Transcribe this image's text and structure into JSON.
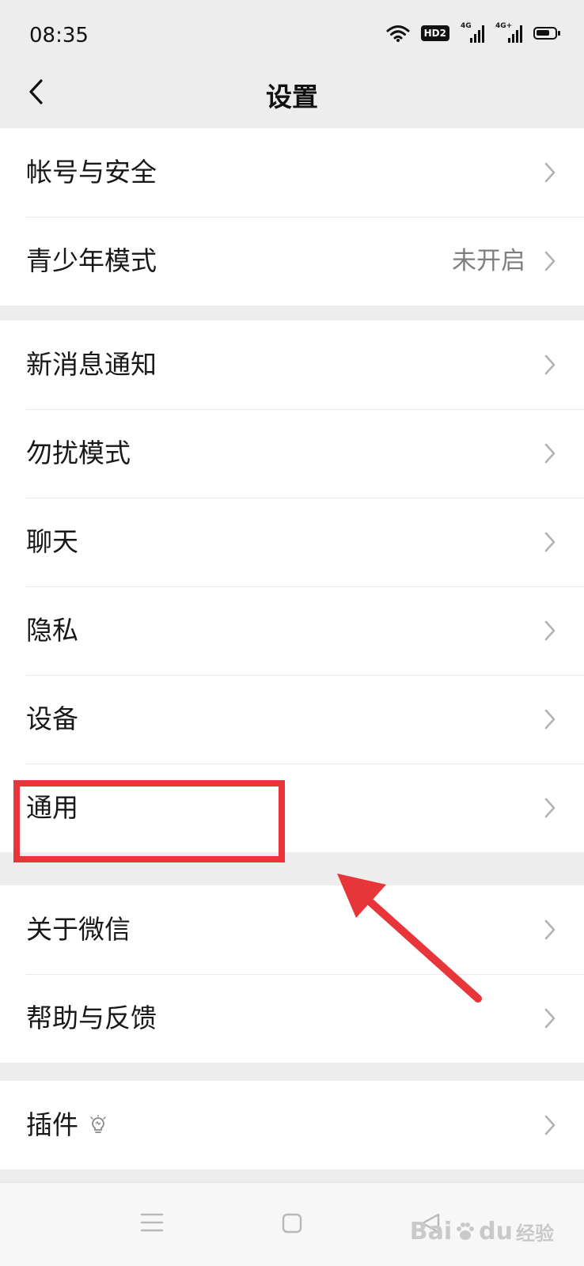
{
  "status_bar": {
    "time": "08:35",
    "hd_label": "HD2",
    "signal1_label": "4G",
    "signal2_label": "4G+"
  },
  "header": {
    "title": "设置"
  },
  "groups": [
    {
      "items": [
        {
          "label": "帐号与安全",
          "value": ""
        },
        {
          "label": "青少年模式",
          "value": "未开启"
        }
      ]
    },
    {
      "items": [
        {
          "label": "新消息通知",
          "value": ""
        },
        {
          "label": "勿扰模式",
          "value": ""
        },
        {
          "label": "聊天",
          "value": ""
        },
        {
          "label": "隐私",
          "value": ""
        },
        {
          "label": "设备",
          "value": ""
        },
        {
          "label": "通用",
          "value": ""
        }
      ]
    },
    {
      "items": [
        {
          "label": "关于微信",
          "value": ""
        },
        {
          "label": "帮助与反馈",
          "value": ""
        }
      ]
    },
    {
      "items": [
        {
          "label": "插件",
          "value": "",
          "icon": "lightbulb-icon"
        }
      ]
    }
  ],
  "annotation": {
    "highlighted_item": "通用",
    "color": "#e8353a"
  },
  "watermark": {
    "brand": "Bai",
    "brand2": "du",
    "suffix": "经验"
  },
  "colors": {
    "background": "#ededed",
    "card": "#ffffff",
    "secondary_text": "#7f7f7f",
    "chevron": "#b2b2b2"
  }
}
